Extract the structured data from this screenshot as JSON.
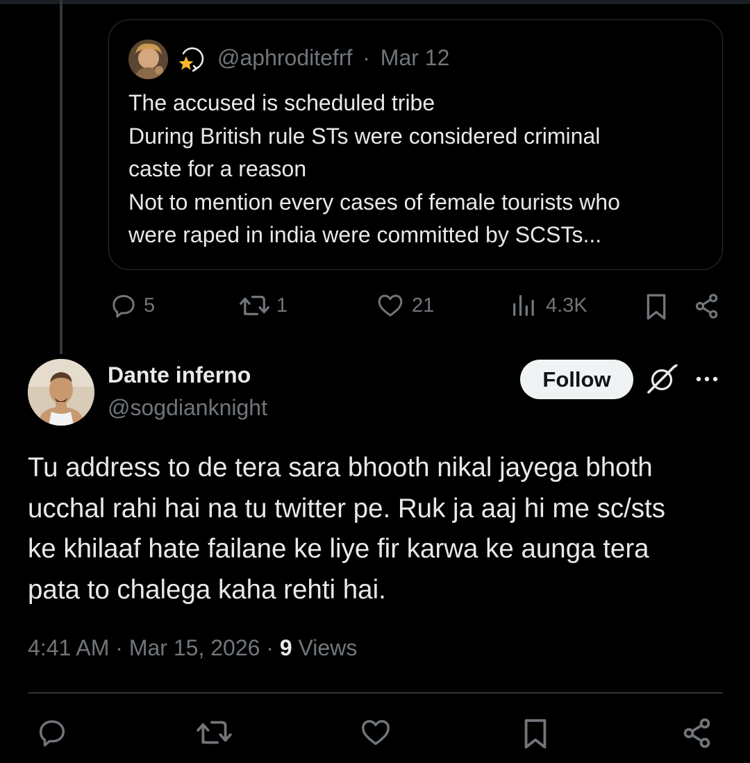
{
  "quoted_tweet": {
    "handle": "@aphroditefrf",
    "separator": "·",
    "date": "Mar 12",
    "lines": [
      "The accused is scheduled tribe",
      "During British rule STs were considered criminal",
      "caste for a reason",
      "Not to mention every cases of female tourists who",
      "were raped in india were committed by SCSTs..."
    ]
  },
  "parent_actions": {
    "replies": "5",
    "reposts": "1",
    "likes": "21",
    "views": "4.3K"
  },
  "reply": {
    "author_name": "Dante inferno",
    "author_handle": "@sogdianknight",
    "follow_label": "Follow",
    "text_lines": [
      "Tu address to de tera sara bhooth nikal jayega bhoth",
      "ucchal rahi hai na tu twitter pe. Ruk ja aaj hi me sc/sts",
      "ke khilaaf hate failane ke liye fir karwa ke aunga tera",
      "pata to chalega kaha rehti hai."
    ],
    "time": "4:41 AM",
    "date": "Mar 15, 2026",
    "views_count": "9",
    "views_label": "Views"
  },
  "icons": {
    "reply": "speech-bubble-icon",
    "repost": "repost-icon",
    "like": "heart-icon",
    "views": "bar-chart-icon",
    "bookmark": "bookmark-icon",
    "share": "share-icon",
    "grok": "grok-icon",
    "more": "more-dots-icon",
    "badge": "star-badge-icon"
  },
  "colors": {
    "background": "#000000",
    "text_primary": "#e7e9ea",
    "text_secondary": "#71767b",
    "border": "#2f3336",
    "follow_bg": "#eff3f4"
  }
}
